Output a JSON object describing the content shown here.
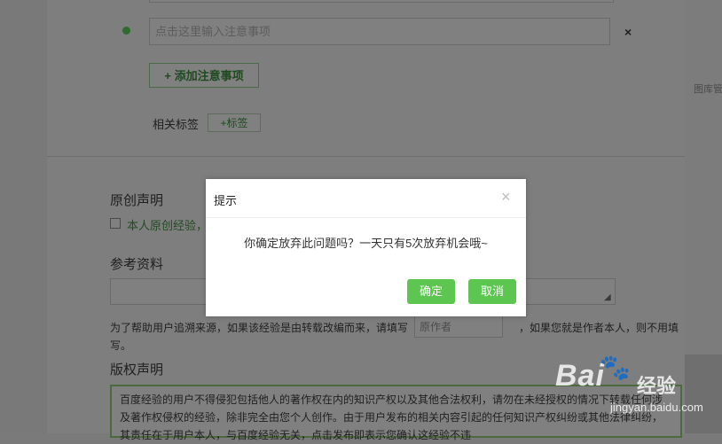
{
  "side": {
    "right_label": "图库管"
  },
  "notes": {
    "input_placeholder": "点击这里输入注意事项",
    "add_label": "+ 添加注意事项",
    "remove_icon": "×"
  },
  "tags": {
    "label": "相关标签",
    "add_label": "+标签"
  },
  "original": {
    "title": "原创声明",
    "checkbox_label": "本人原创经验，"
  },
  "reference": {
    "title": "参考资料",
    "help_text_1": "为了帮助用户追溯来源，如果该经验是由转载改编而来，请填写",
    "help_text_2": "写。",
    "author_placeholder": "原作者",
    "help_tail": "，如果您就是作者本人，则不用填"
  },
  "copyright": {
    "title": "版权声明",
    "text": "百度经验的用户不得侵犯包括他人的著作权在内的知识产权以及其他合法权利，请勿在未经授权的情况下转载任何涉及著作权侵权的经验，除非完全由您个人创作。由于用户发布的相关内容引起的任何知识产权纠纷或其他法律纠纷，其责任在于用户本人，与百度经验无关，点击发布即表示您确认这经验不违"
  },
  "watermark": {
    "brand": "Bai",
    "paw": "🐾",
    "jingyan": "经验",
    "url": "jingyan.baidu.com"
  },
  "modal": {
    "title": "提示",
    "close_icon": "×",
    "message": "你确定放弃此问题吗？一天只有5次放弃机会哦~",
    "ok_label": "确定",
    "cancel_label": "取消"
  },
  "colors": {
    "accent_green": "#5cc650",
    "overlay": "#7e7e7e"
  }
}
